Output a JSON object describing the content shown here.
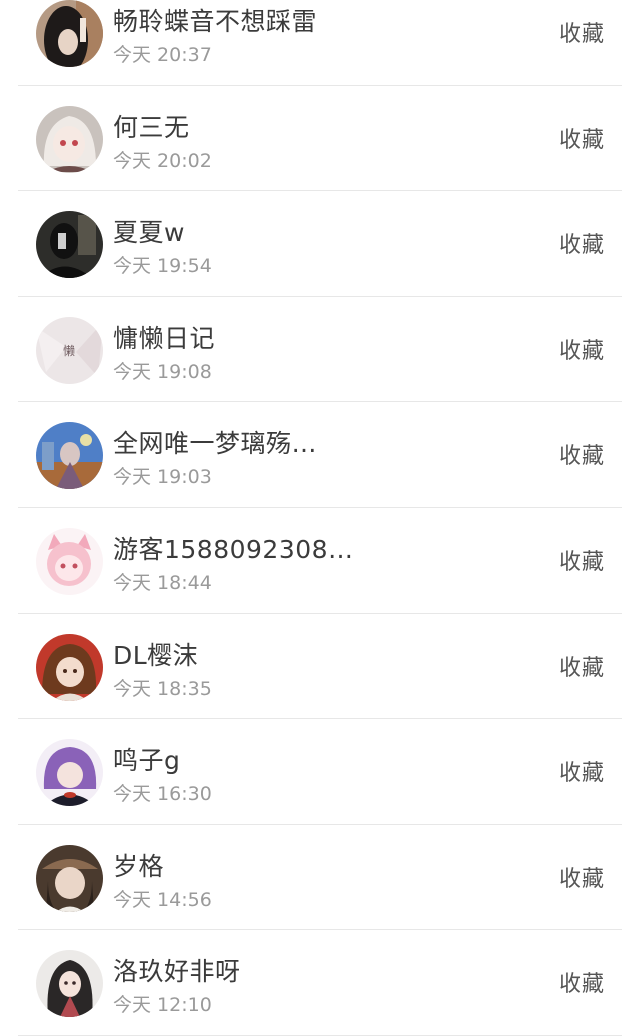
{
  "followers": [
    {
      "name": "畅聆蝶音不想踩雷",
      "time": "今天 20:37",
      "action": "收藏",
      "avatar": "dark-hair-portrait"
    },
    {
      "name": "何三无",
      "time": "今天 20:02",
      "action": "收藏",
      "avatar": "anime-white-hair"
    },
    {
      "name": "夏夏w",
      "time": "今天 19:54",
      "action": "收藏",
      "avatar": "dark-silhouette"
    },
    {
      "name": "慵懒日记",
      "time": "今天 19:08",
      "action": "收藏",
      "avatar": "text-lazy-icon"
    },
    {
      "name": "全网唯一梦璃殇…",
      "time": "今天 19:03",
      "action": "收藏",
      "avatar": "anime-scene"
    },
    {
      "name": "游客1588092308…",
      "time": "今天 18:44",
      "action": "收藏",
      "avatar": "pink-cat-girl"
    },
    {
      "name": "DL樱沫",
      "time": "今天 18:35",
      "action": "收藏",
      "avatar": "anime-brown-hair-red"
    },
    {
      "name": "鸣子g",
      "time": "今天 16:30",
      "action": "收藏",
      "avatar": "anime-purple-hair"
    },
    {
      "name": "岁格",
      "time": "今天 14:56",
      "action": "收藏",
      "avatar": "anime-hat-dark"
    },
    {
      "name": "洛玖好非呀",
      "time": "今天 12:10",
      "action": "收藏",
      "avatar": "anime-long-black-hair"
    }
  ]
}
